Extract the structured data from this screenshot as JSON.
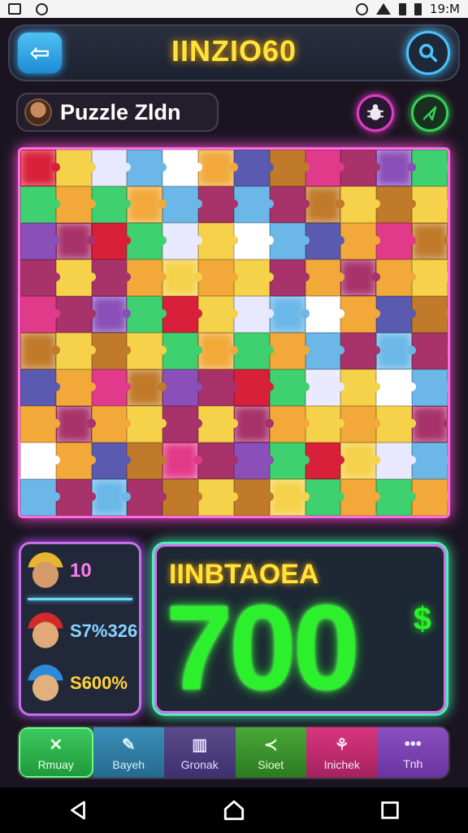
{
  "status_bar": {
    "time": "19:M"
  },
  "header": {
    "title": "IINZIO60",
    "back_icon": "arrow-left-icon",
    "search_icon": "search-icon"
  },
  "puzzle": {
    "name": "Puzzle Zldn"
  },
  "stats": [
    {
      "value": "10"
    },
    {
      "value": "S7%326"
    },
    {
      "value": "S600%"
    }
  ],
  "score": {
    "label": "IINBTAOEA",
    "value": "700",
    "currency": "$"
  },
  "tabs": [
    {
      "label": "Rmuay",
      "icon": "✕"
    },
    {
      "label": "Bayeh",
      "icon": "✎"
    },
    {
      "label": "Gronak",
      "icon": "▥"
    },
    {
      "label": "Sioet",
      "icon": "≺"
    },
    {
      "label": "Inichek",
      "icon": "⚘"
    },
    {
      "label": "Tnh",
      "icon": "•••"
    }
  ],
  "colors": {
    "accent_yellow": "#ffe23a",
    "accent_green": "#2cf02c",
    "board_glow": "#ff4fd8",
    "board_palette": [
      "#d8203a",
      "#f2a93a",
      "#8a4fb8",
      "#6ab7e8",
      "#e23a8a",
      "#f5d24a",
      "#5a5ab0",
      "#3fd070",
      "#ffffff",
      "#a8326a",
      "#e8e8ff",
      "#c07a2a"
    ]
  }
}
